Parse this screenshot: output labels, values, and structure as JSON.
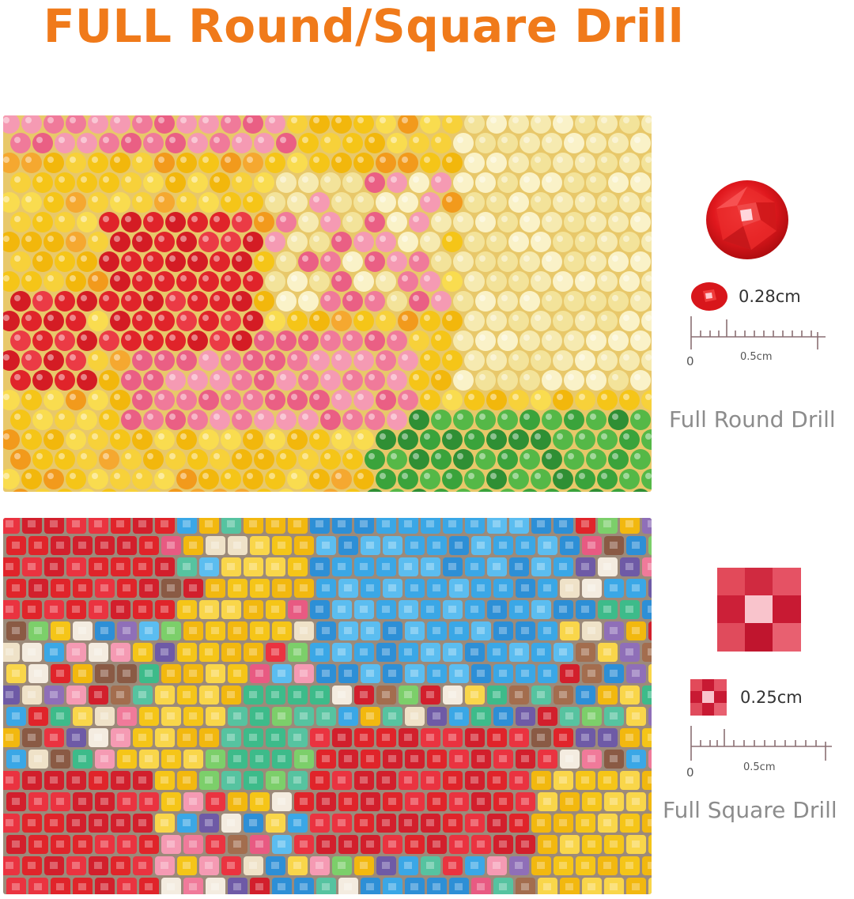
{
  "title": "FULL Round/Square Drill",
  "round": {
    "size_label": "0.28cm",
    "ruler_zero": "0",
    "ruler_mid": "0.5cm",
    "caption": "Full Round Drill",
    "gem_color": "#e0181d"
  },
  "square": {
    "size_label": "0.25cm",
    "ruler_zero": "0",
    "ruler_mid": "0.5cm",
    "caption": "Full Square Drill",
    "gem_color": "#d9243d"
  },
  "colors": {
    "title": "#f07a1a",
    "caption": "#8c8c8c",
    "ruler": "#8a6f73"
  }
}
